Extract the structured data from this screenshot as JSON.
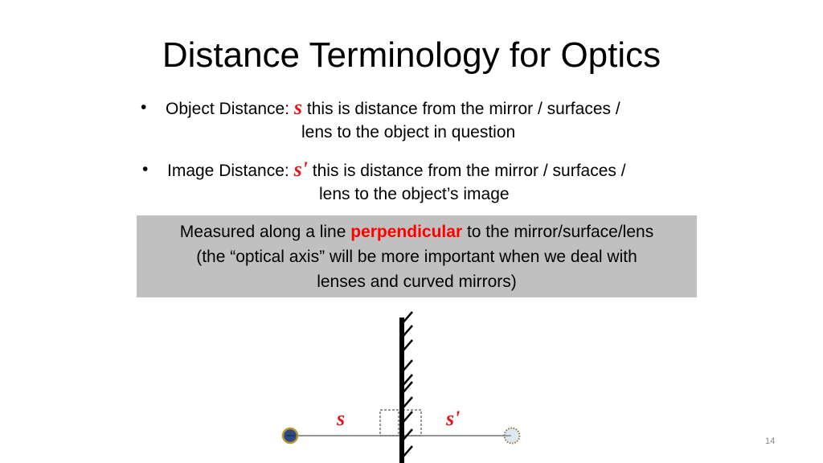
{
  "slide": {
    "title": "Distance Terminology for Optics",
    "bullets": [
      {
        "label": "Object Distance:",
        "symbol": "s",
        "text_line1": "this is distance from the mirror / surfaces /",
        "text_line2": "lens to the object in question"
      },
      {
        "label": "Image Distance:",
        "symbol": "s'",
        "text_line1": "this is distance from the mirror / surfaces /",
        "text_line2": "lens to the object’s image"
      }
    ],
    "callout": {
      "before": "Measured along a line ",
      "highlight": "perpendicular",
      "after": " to the mirror/surface/lens",
      "line2": "(the “optical axis” will be more important when we deal with",
      "line3": "lenses and curved mirrors)"
    },
    "diagram": {
      "object_label": "s",
      "image_label": "s'",
      "colors": {
        "object_fill": "#2e4a86",
        "object_ring": "#b8962e",
        "image_fill": "#dde7f2",
        "image_ring": "#8a7a2a",
        "label_color": "#e8141a",
        "mirror": "#000000"
      }
    },
    "page_number": "14"
  },
  "colors": {
    "accent_red": "#ff0000",
    "callout_bg": "#c0c0c0"
  }
}
